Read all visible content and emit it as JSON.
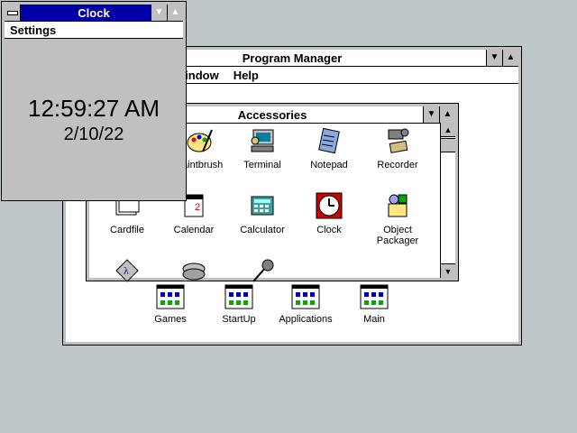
{
  "program_manager": {
    "title": "Program Manager",
    "menu": [
      "Window",
      "Help"
    ],
    "group_icons": [
      {
        "label": "Games",
        "icon": "program-group-icon"
      },
      {
        "label": "StartUp",
        "icon": "program-group-icon"
      },
      {
        "label": "Applications",
        "icon": "program-group-icon"
      },
      {
        "label": "Main",
        "icon": "program-group-icon"
      }
    ]
  },
  "accessories": {
    "title": "Accessories",
    "icons": [
      {
        "label": "Paintbrush",
        "icon": "paintbrush-icon"
      },
      {
        "label": "Terminal",
        "icon": "terminal-icon"
      },
      {
        "label": "Notepad",
        "icon": "notepad-icon"
      },
      {
        "label": "Recorder",
        "icon": "recorder-icon"
      },
      {
        "label": "Cardfile",
        "icon": "cardfile-icon"
      },
      {
        "label": "Calendar",
        "icon": "calendar-icon"
      },
      {
        "label": "Calculator",
        "icon": "calculator-icon"
      },
      {
        "label": "Clock",
        "icon": "clock-icon"
      },
      {
        "label": "Object\nPackager",
        "icon": "object-packager-icon"
      },
      {
        "label": "",
        "icon": "character-map-icon"
      },
      {
        "label": "",
        "icon": "media-player-icon"
      },
      {
        "label": "",
        "icon": "sound-recorder-icon"
      }
    ]
  },
  "clock": {
    "title": "Clock",
    "menu": [
      "Settings"
    ],
    "time": "12:59:27 AM",
    "date": "2/10/22"
  },
  "colors": {
    "desktop": "#c0c7c8",
    "active_title": "#0000a8",
    "face": "#c0c0c0"
  }
}
